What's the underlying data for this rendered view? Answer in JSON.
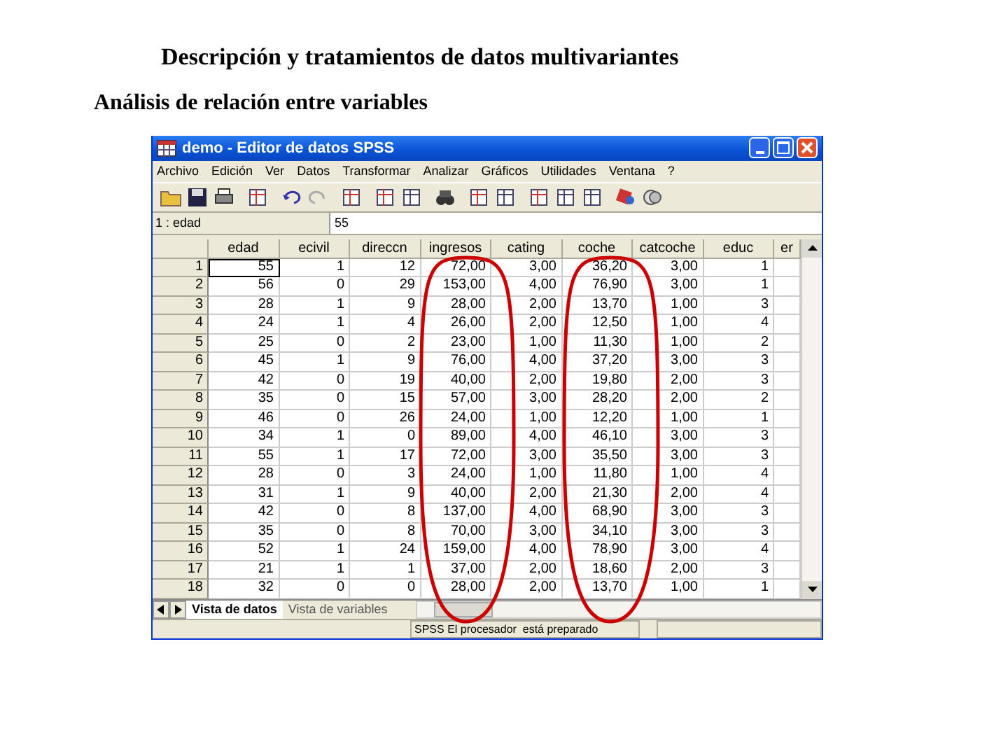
{
  "slide": {
    "title": "Descripción y tratamientos de datos multivariantes",
    "subtitle": "Análisis de relación entre variables"
  },
  "window": {
    "title": "demo - Editor de datos SPSS"
  },
  "menu": [
    "Archivo",
    "Edición",
    "Ver",
    "Datos",
    "Transformar",
    "Analizar",
    "Gráficos",
    "Utilidades",
    "Ventana",
    "?"
  ],
  "cell_editor": {
    "cell": "1 : edad",
    "value": "55"
  },
  "table": {
    "columns": [
      "edad",
      "ecivil",
      "direccn",
      "ingresos",
      "cating",
      "coche",
      "catcoche",
      "educ",
      "er"
    ],
    "rows": [
      {
        "number": "1",
        "focused": true,
        "cells": [
          "55",
          "1",
          "12",
          "72,00",
          "3,00",
          "36,20",
          "3,00",
          "1"
        ]
      },
      {
        "number": "2",
        "focused": false,
        "cells": [
          "56",
          "0",
          "29",
          "153,00",
          "4,00",
          "76,90",
          "3,00",
          "1"
        ]
      },
      {
        "number": "3",
        "focused": false,
        "cells": [
          "28",
          "1",
          "9",
          "28,00",
          "2,00",
          "13,70",
          "1,00",
          "3"
        ]
      },
      {
        "number": "4",
        "focused": false,
        "cells": [
          "24",
          "1",
          "4",
          "26,00",
          "2,00",
          "12,50",
          "1,00",
          "4"
        ]
      },
      {
        "number": "5",
        "focused": false,
        "cells": [
          "25",
          "0",
          "2",
          "23,00",
          "1,00",
          "11,30",
          "1,00",
          "2"
        ]
      },
      {
        "number": "6",
        "focused": false,
        "cells": [
          "45",
          "1",
          "9",
          "76,00",
          "4,00",
          "37,20",
          "3,00",
          "3"
        ]
      },
      {
        "number": "7",
        "focused": false,
        "cells": [
          "42",
          "0",
          "19",
          "40,00",
          "2,00",
          "19,80",
          "2,00",
          "3"
        ]
      },
      {
        "number": "8",
        "focused": false,
        "cells": [
          "35",
          "0",
          "15",
          "57,00",
          "3,00",
          "28,20",
          "2,00",
          "2"
        ]
      },
      {
        "number": "9",
        "focused": false,
        "cells": [
          "46",
          "0",
          "26",
          "24,00",
          "1,00",
          "12,20",
          "1,00",
          "1"
        ]
      },
      {
        "number": "10",
        "focused": false,
        "cells": [
          "34",
          "1",
          "0",
          "89,00",
          "4,00",
          "46,10",
          "3,00",
          "3"
        ]
      },
      {
        "number": "11",
        "focused": false,
        "cells": [
          "55",
          "1",
          "17",
          "72,00",
          "3,00",
          "35,50",
          "3,00",
          "3"
        ]
      },
      {
        "number": "12",
        "focused": false,
        "cells": [
          "28",
          "0",
          "3",
          "24,00",
          "1,00",
          "11,80",
          "1,00",
          "4"
        ]
      },
      {
        "number": "13",
        "focused": false,
        "cells": [
          "31",
          "1",
          "9",
          "40,00",
          "2,00",
          "21,30",
          "2,00",
          "4"
        ]
      },
      {
        "number": "14",
        "focused": false,
        "cells": [
          "42",
          "0",
          "8",
          "137,00",
          "4,00",
          "68,90",
          "3,00",
          "3"
        ]
      },
      {
        "number": "15",
        "focused": false,
        "cells": [
          "35",
          "0",
          "8",
          "70,00",
          "3,00",
          "34,10",
          "3,00",
          "3"
        ]
      },
      {
        "number": "16",
        "focused": false,
        "cells": [
          "52",
          "1",
          "24",
          "159,00",
          "4,00",
          "78,90",
          "3,00",
          "4"
        ]
      },
      {
        "number": "17",
        "focused": false,
        "cells": [
          "21",
          "1",
          "1",
          "37,00",
          "2,00",
          "18,60",
          "2,00",
          "3"
        ]
      },
      {
        "number": "18",
        "focused": false,
        "cells": [
          "32",
          "0",
          "0",
          "28,00",
          "2,00",
          "13,70",
          "1,00",
          "1"
        ]
      }
    ]
  },
  "tabs": [
    {
      "label": "Vista de datos",
      "selected": true
    },
    {
      "label": "Vista de variables",
      "selected": false
    }
  ],
  "status_bar": "SPSS El procesador  está preparado"
}
